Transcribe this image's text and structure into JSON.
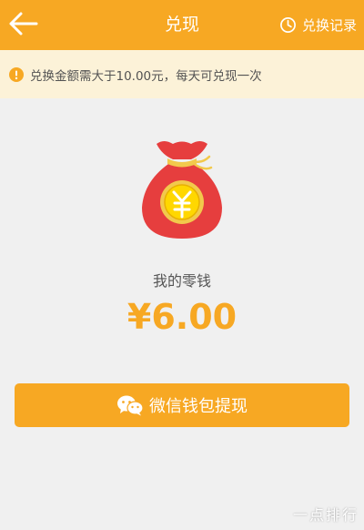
{
  "header": {
    "title": "兑现",
    "history_label": "兑换记录"
  },
  "notice": {
    "text": "兑换金额需大于10.00元，每天可兑现一次"
  },
  "wallet": {
    "label": "我的零钱",
    "amount": "¥6.00"
  },
  "actions": {
    "withdraw_label": "微信钱包提现"
  },
  "watermark": "一点排行",
  "icons": {
    "back": "back-arrow-icon",
    "history": "clock-icon",
    "notice": "warning-icon",
    "bag": "money-bag-icon",
    "withdraw": "wechat-icon"
  },
  "colors": {
    "accent": "#f7a823",
    "notice_bg": "#fcf2d8",
    "page_bg": "#f0f0f0",
    "bag_red": "#e63e3e",
    "coin_yellow": "#ffd700"
  }
}
